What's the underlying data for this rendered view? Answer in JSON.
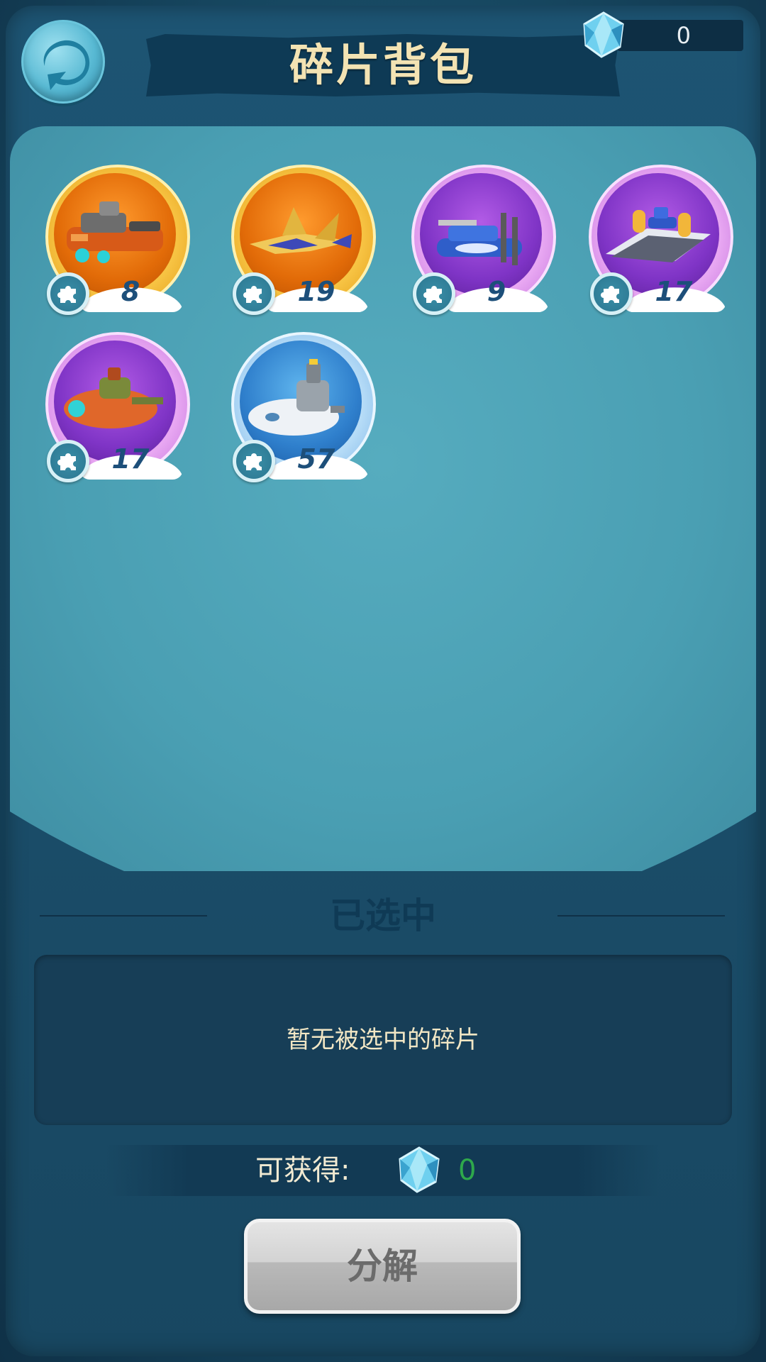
{
  "header": {
    "title": "碎片背包",
    "currency_value": "0"
  },
  "inventory": {
    "items": [
      {
        "count": "8",
        "rarity": "gold",
        "icon": "orange-battleship-icon"
      },
      {
        "count": "19",
        "rarity": "gold",
        "icon": "gold-stealth-jet-icon"
      },
      {
        "count": "9",
        "rarity": "purple",
        "icon": "blue-warship-icon"
      },
      {
        "count": "17",
        "rarity": "purple",
        "icon": "carrier-ship-icon"
      },
      {
        "count": "17",
        "rarity": "purple",
        "icon": "orange-submarine-icon"
      },
      {
        "count": "57",
        "rarity": "blue",
        "icon": "white-submarine-icon"
      }
    ]
  },
  "selected": {
    "title": "已选中",
    "empty_text": "暂无被选中的碎片"
  },
  "obtain": {
    "label": "可获得:",
    "value": "0"
  },
  "actions": {
    "decompose_label": "分解"
  },
  "colors": {
    "panel": "#4a9fb3",
    "title_text": "#f3e3b3",
    "count_text": "#1d4f7a",
    "obtain_value": "#2ea84b"
  }
}
